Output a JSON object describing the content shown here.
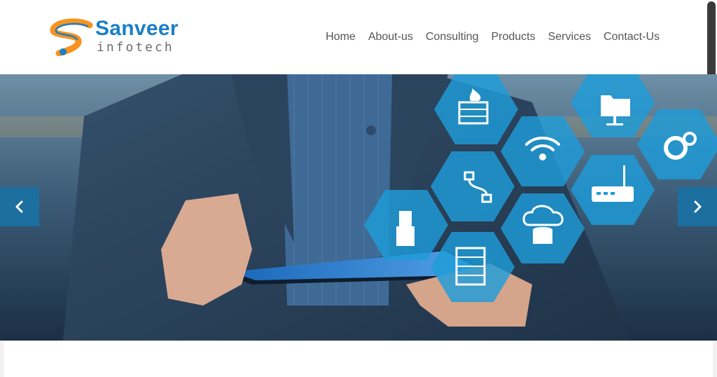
{
  "brand": {
    "name": "Sanveer",
    "tagline": "infotech",
    "primary_color": "#1a7fc6",
    "accent_color": "#f7931e"
  },
  "nav": {
    "items": [
      "Home",
      "About-us",
      "Consulting",
      "Products",
      "Services",
      "Contact-Us"
    ]
  },
  "hero": {
    "icons": [
      "firewall-icon",
      "folder-network-icon",
      "wifi-icon",
      "gears-icon",
      "cable-icon",
      "router-icon",
      "ethernet-plug-icon",
      "cloud-database-icon",
      "server-rack-icon"
    ],
    "arrow_color": "#1d6f9f"
  }
}
